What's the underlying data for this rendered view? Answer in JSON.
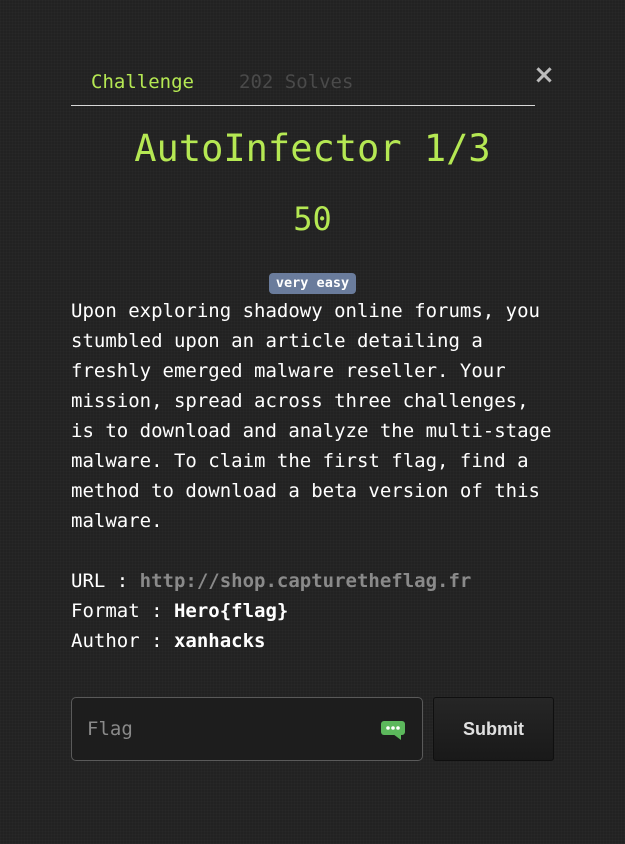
{
  "tabs": {
    "challenge": "Challenge",
    "solves": "202 Solves"
  },
  "close_label": "×",
  "challenge": {
    "title": "AutoInfector 1/3",
    "points": "50",
    "difficulty": "very easy",
    "description": "Upon exploring shadowy online forums, you stumbled upon an article detailing a freshly emerged malware reseller. Your mission, spread across three challenges, is to download and analyze the multi-stage malware. To claim the first flag, find a method to download a beta version of this malware.",
    "url_label": "URL : ",
    "url": "http://shop.capturetheflag.fr",
    "format_label": "Format : ",
    "format": "Hero{flag}",
    "author_label": "Author : ",
    "author": "xanhacks"
  },
  "form": {
    "flag_placeholder": "Flag",
    "flag_value": "",
    "submit_label": "Submit"
  },
  "colors": {
    "background": "#222222",
    "accent": "#b5e853",
    "badge": "#6a7c9c",
    "muted": "#4a4a4a",
    "icon_green": "#5cb85c"
  },
  "icons": {
    "close": "close-icon",
    "flag_input": "chat-bubble-icon"
  }
}
